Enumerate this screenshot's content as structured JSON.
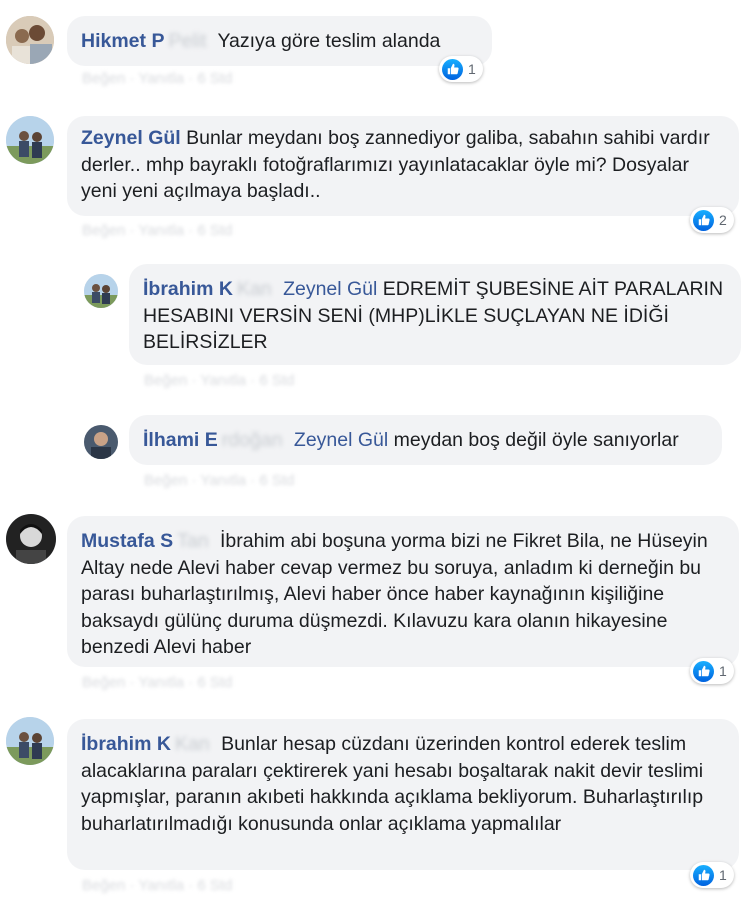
{
  "colors": {
    "name": "#385898",
    "bubble": "#f2f3f5",
    "like": "#1877f2"
  },
  "comments": [
    {
      "author": "Hikmet P",
      "text": "Yazıya göre teslim alanda",
      "likes": "1"
    },
    {
      "author": "Zeynel Gül",
      "text": "Bunlar meydanı boş zannediyor galiba, sabahın sahibi vardır derler.. mhp bayraklı fotoğraflarımızı yayınlatacaklar öyle mi? Dosyalar yeni yeni açılmaya başladı..",
      "likes": "2"
    },
    {
      "author": "İbrahim K",
      "mention": "Zeynel Gül",
      "text": "EDREMİT ŞUBESİNE AİT PARALARIN HESABINI VERSİN SENİ (MHP)LİKLE SUÇLAYAN NE İDİĞİ BELİRSİZLER"
    },
    {
      "author": "İlhami E",
      "mention": "Zeynel Gül",
      "text": "meydan boş değil öyle sanıyorlar"
    },
    {
      "author": "Mustafa S",
      "text": "İbrahim abi boşuna yorma bizi ne Fikret Bila, ne Hüseyin Altay nede Alevi haber cevap vermez bu soruya, anladım ki derneğin bu parası buharlaştırılmış, Alevi haber önce haber kaynağının kişiliğine baksaydı gülünç duruma düşmezdi. Kılavuzu kara olanın hikayesine benzedi Alevi haber",
      "likes": "1"
    },
    {
      "author": "İbrahim K",
      "text": "Bunlar hesap cüzdanı üzerinden kontrol ederek teslim alacaklarına paraları çektirerek yani hesabı boşaltarak nakit devir teslimi yapmışlar, paranın akıbeti hakkında açıklama bekliyorum. Buharlaştırılıp buharlatırılmadığı konusunda onlar açıklama yapmalılar",
      "likes": "1"
    }
  ]
}
